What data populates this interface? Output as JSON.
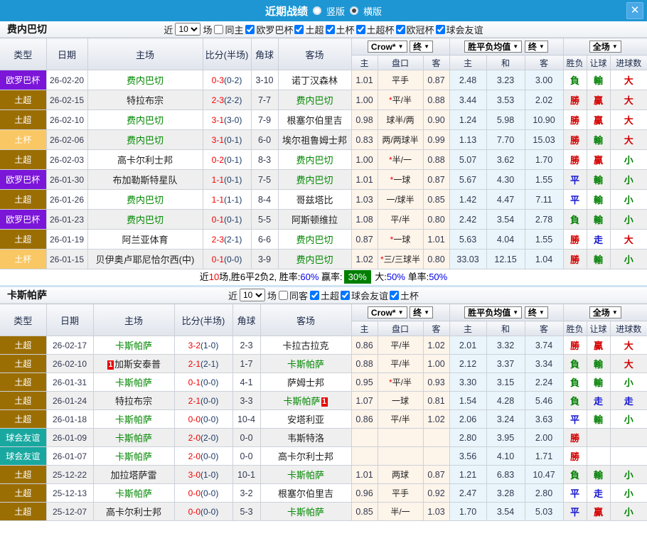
{
  "titlebar": {
    "title": "近期战绩",
    "layout_options": [
      {
        "label": "竖版",
        "checked": false
      },
      {
        "label": "横版",
        "checked": true
      }
    ],
    "close_icon": "✕"
  },
  "table_header": {
    "type": "类型",
    "date": "日期",
    "home": "主场",
    "score": "比分(半场)",
    "corner": "角球",
    "away": "客场",
    "crow": "Crow*",
    "final": "终",
    "avg": "胜平负均值",
    "full": "全场",
    "arrow": "▼",
    "sub": {
      "h": "主",
      "pan": "盘口",
      "a": "客",
      "mh": "主",
      "md": "和",
      "ma": "客",
      "res": "胜负",
      "let": "让球",
      "goal": "进球数"
    }
  },
  "type_colors": {
    "欧罗巴杯": "#7b16d8",
    "土超": "#9b6e04",
    "土杯": "#f9c763",
    "球会友谊": "#19a8a0"
  },
  "result_color_map": {
    "勝": "red",
    "負": "green",
    "平": "blue",
    "贏": "red",
    "輸": "green",
    "走": "blue",
    "大": "red",
    "小": "green"
  },
  "red_card_label": "1",
  "sections": [
    {
      "team": "费内巴切",
      "filter": {
        "label_near": "近",
        "count": "10",
        "label_games": "场",
        "same_label": "同主",
        "same_checked": false,
        "leagues": [
          {
            "label": "欧罗巴杯",
            "checked": true
          },
          {
            "label": "土超",
            "checked": true
          },
          {
            "label": "土杯",
            "checked": true
          },
          {
            "label": "土超杯",
            "checked": true
          },
          {
            "label": "欧冠杯",
            "checked": true
          },
          {
            "label": "球会友谊",
            "checked": true
          }
        ]
      },
      "rows": [
        {
          "type": "欧罗巴杯",
          "date": "26-02-20",
          "home": "费内巴切",
          "hg": true,
          "hcard": false,
          "away": "诺丁汉森林",
          "ag": false,
          "acard": false,
          "score": "0-3",
          "half": "(0-2)",
          "corner": "3-10",
          "oh": "1.01",
          "pan": "平手",
          "oa": "0.87",
          "mh": "2.48",
          "md": "3.23",
          "ma": "3.00",
          "r_wdl": "負",
          "r_let": "輸",
          "r_goal": "大"
        },
        {
          "type": "土超",
          "date": "26-02-15",
          "home": "特拉布宗",
          "hg": false,
          "hcard": false,
          "away": "费内巴切",
          "ag": true,
          "acard": false,
          "score": "2-3",
          "half": "(2-2)",
          "corner": "7-7",
          "oh": "1.00",
          "pan": "*平/半",
          "oa": "0.88",
          "mh": "3.44",
          "md": "3.53",
          "ma": "2.02",
          "r_wdl": "勝",
          "r_let": "贏",
          "r_goal": "大"
        },
        {
          "type": "土超",
          "date": "26-02-10",
          "home": "费内巴切",
          "hg": true,
          "hcard": false,
          "away": "根塞尔伯里吉",
          "ag": false,
          "acard": false,
          "score": "3-1",
          "half": "(3-0)",
          "corner": "7-9",
          "oh": "0.98",
          "pan": "球半/两",
          "oa": "0.90",
          "mh": "1.24",
          "md": "5.98",
          "ma": "10.90",
          "r_wdl": "勝",
          "r_let": "贏",
          "r_goal": "大"
        },
        {
          "type": "土杯",
          "date": "26-02-06",
          "home": "费内巴切",
          "hg": true,
          "hcard": false,
          "away": "埃尔祖鲁姆士邦",
          "ag": false,
          "acard": false,
          "score": "3-1",
          "half": "(0-1)",
          "corner": "6-0",
          "oh": "0.83",
          "pan": "两/两球半",
          "oa": "0.99",
          "mh": "1.13",
          "md": "7.70",
          "ma": "15.03",
          "r_wdl": "勝",
          "r_let": "輸",
          "r_goal": "大"
        },
        {
          "type": "土超",
          "date": "26-02-03",
          "home": "高卡尔利士邦",
          "hg": false,
          "hcard": false,
          "away": "费内巴切",
          "ag": true,
          "acard": false,
          "score": "0-2",
          "half": "(0-1)",
          "corner": "8-3",
          "oh": "1.00",
          "pan": "*半/一",
          "oa": "0.88",
          "mh": "5.07",
          "md": "3.62",
          "ma": "1.70",
          "r_wdl": "勝",
          "r_let": "贏",
          "r_goal": "小"
        },
        {
          "type": "欧罗巴杯",
          "date": "26-01-30",
          "home": "布加勒斯特星队",
          "hg": false,
          "hcard": false,
          "away": "费内巴切",
          "ag": true,
          "acard": false,
          "score": "1-1",
          "half": "(0-1)",
          "corner": "7-5",
          "oh": "1.01",
          "pan": "*一球",
          "oa": "0.87",
          "mh": "5.67",
          "md": "4.30",
          "ma": "1.55",
          "r_wdl": "平",
          "r_let": "輸",
          "r_goal": "小"
        },
        {
          "type": "土超",
          "date": "26-01-26",
          "home": "费内巴切",
          "hg": true,
          "hcard": false,
          "away": "哥兹塔比",
          "ag": false,
          "acard": false,
          "score": "1-1",
          "half": "(1-1)",
          "corner": "8-4",
          "oh": "1.03",
          "pan": "一/球半",
          "oa": "0.85",
          "mh": "1.42",
          "md": "4.47",
          "ma": "7.11",
          "r_wdl": "平",
          "r_let": "輸",
          "r_goal": "小"
        },
        {
          "type": "欧罗巴杯",
          "date": "26-01-23",
          "home": "费内巴切",
          "hg": true,
          "hcard": false,
          "away": "阿斯顿维拉",
          "ag": false,
          "acard": false,
          "score": "0-1",
          "half": "(0-1)",
          "corner": "5-5",
          "oh": "1.08",
          "pan": "平/半",
          "oa": "0.80",
          "mh": "2.42",
          "md": "3.54",
          "ma": "2.78",
          "r_wdl": "負",
          "r_let": "輸",
          "r_goal": "小"
        },
        {
          "type": "土超",
          "date": "26-01-19",
          "home": "阿兰亚体育",
          "hg": false,
          "hcard": false,
          "away": "费内巴切",
          "ag": true,
          "acard": false,
          "score": "2-3",
          "half": "(2-1)",
          "corner": "6-6",
          "oh": "0.87",
          "pan": "*一球",
          "oa": "1.01",
          "mh": "5.63",
          "md": "4.04",
          "ma": "1.55",
          "r_wdl": "勝",
          "r_let": "走",
          "r_goal": "大"
        },
        {
          "type": "土杯",
          "date": "26-01-15",
          "home": "贝伊奥卢耶尼恰尔西(中)",
          "hg": false,
          "hcard": false,
          "away": "费内巴切",
          "ag": true,
          "acard": false,
          "score": "0-1",
          "half": "(0-0)",
          "corner": "3-9",
          "oh": "1.02",
          "pan": "*三/三球半",
          "oa": "0.80",
          "mh": "33.03",
          "md": "12.15",
          "ma": "1.04",
          "r_wdl": "勝",
          "r_let": "輸",
          "r_goal": "小"
        }
      ],
      "summary": [
        {
          "style": "plain",
          "text": "近"
        },
        {
          "style": "red",
          "text": "10"
        },
        {
          "style": "plain",
          "text": "场,胜6平2负2, 胜率:"
        },
        {
          "style": "blue",
          "text": "60%"
        },
        {
          "style": "plain",
          "text": " 赢率:"
        },
        {
          "style": "hl",
          "text": "30%"
        },
        {
          "style": "plain",
          "text": " 大:"
        },
        {
          "style": "blue",
          "text": "50%"
        },
        {
          "style": "plain",
          "text": " 单率:"
        },
        {
          "style": "blue",
          "text": "50%"
        }
      ]
    },
    {
      "team": "卡斯帕萨",
      "filter": {
        "label_near": "近",
        "count": "10",
        "label_games": "场",
        "same_label": "同客",
        "same_checked": false,
        "leagues": [
          {
            "label": "土超",
            "checked": true
          },
          {
            "label": "球会友谊",
            "checked": true
          },
          {
            "label": "土杯",
            "checked": true
          }
        ]
      },
      "rows": [
        {
          "type": "土超",
          "date": "26-02-17",
          "home": "卡斯帕萨",
          "hg": true,
          "hcard": false,
          "away": "卡拉古拉克",
          "ag": false,
          "acard": false,
          "score": "3-2",
          "half": "(1-0)",
          "corner": "2-3",
          "oh": "0.86",
          "pan": "平/半",
          "oa": "1.02",
          "mh": "2.01",
          "md": "3.32",
          "ma": "3.74",
          "r_wdl": "勝",
          "r_let": "贏",
          "r_goal": "大"
        },
        {
          "type": "土超",
          "date": "26-02-10",
          "home": "加斯安泰普",
          "hg": false,
          "hcard": true,
          "away": "卡斯帕萨",
          "ag": true,
          "acard": false,
          "score": "2-1",
          "half": "(2-1)",
          "corner": "1-7",
          "oh": "0.88",
          "pan": "平/半",
          "oa": "1.00",
          "mh": "2.12",
          "md": "3.37",
          "ma": "3.34",
          "r_wdl": "負",
          "r_let": "輸",
          "r_goal": "大"
        },
        {
          "type": "土超",
          "date": "26-01-31",
          "home": "卡斯帕萨",
          "hg": true,
          "hcard": false,
          "away": "萨姆士邦",
          "ag": false,
          "acard": false,
          "score": "0-1",
          "half": "(0-0)",
          "corner": "4-1",
          "oh": "0.95",
          "pan": "*平/半",
          "oa": "0.93",
          "mh": "3.30",
          "md": "3.15",
          "ma": "2.24",
          "r_wdl": "負",
          "r_let": "輸",
          "r_goal": "小"
        },
        {
          "type": "土超",
          "date": "26-01-24",
          "home": "特拉布宗",
          "hg": false,
          "hcard": false,
          "away": "卡斯帕萨",
          "ag": true,
          "acard": true,
          "score": "2-1",
          "half": "(0-0)",
          "corner": "3-3",
          "oh": "1.07",
          "pan": "一球",
          "oa": "0.81",
          "mh": "1.54",
          "md": "4.28",
          "ma": "5.46",
          "r_wdl": "負",
          "r_let": "走",
          "r_goal": "走"
        },
        {
          "type": "土超",
          "date": "26-01-18",
          "home": "卡斯帕萨",
          "hg": true,
          "hcard": false,
          "away": "安塔利亚",
          "ag": false,
          "acard": false,
          "score": "0-0",
          "half": "(0-0)",
          "corner": "10-4",
          "oh": "0.86",
          "pan": "平/半",
          "oa": "1.02",
          "mh": "2.06",
          "md": "3.24",
          "ma": "3.63",
          "r_wdl": "平",
          "r_let": "輸",
          "r_goal": "小"
        },
        {
          "type": "球会友谊",
          "date": "26-01-09",
          "home": "卡斯帕萨",
          "hg": true,
          "hcard": false,
          "away": "韦斯特洛",
          "ag": false,
          "acard": false,
          "score": "2-0",
          "half": "(2-0)",
          "corner": "0-0",
          "oh": "",
          "pan": "",
          "oa": "",
          "mh": "2.80",
          "md": "3.95",
          "ma": "2.00",
          "r_wdl": "勝",
          "r_let": "",
          "r_goal": ""
        },
        {
          "type": "球会友谊",
          "date": "26-01-07",
          "home": "卡斯帕萨",
          "hg": true,
          "hcard": false,
          "away": "高卡尔利士邦",
          "ag": false,
          "acard": false,
          "score": "2-0",
          "half": "(0-0)",
          "corner": "0-0",
          "oh": "",
          "pan": "",
          "oa": "",
          "mh": "3.56",
          "md": "4.10",
          "ma": "1.71",
          "r_wdl": "勝",
          "r_let": "",
          "r_goal": ""
        },
        {
          "type": "土超",
          "date": "25-12-22",
          "home": "加拉塔萨雷",
          "hg": false,
          "hcard": false,
          "away": "卡斯帕萨",
          "ag": true,
          "acard": false,
          "score": "3-0",
          "half": "(1-0)",
          "corner": "10-1",
          "oh": "1.01",
          "pan": "两球",
          "oa": "0.87",
          "mh": "1.21",
          "md": "6.83",
          "ma": "10.47",
          "r_wdl": "負",
          "r_let": "輸",
          "r_goal": "小"
        },
        {
          "type": "土超",
          "date": "25-12-13",
          "home": "卡斯帕萨",
          "hg": true,
          "hcard": false,
          "away": "根塞尔伯里吉",
          "ag": false,
          "acard": false,
          "score": "0-0",
          "half": "(0-0)",
          "corner": "3-2",
          "oh": "0.96",
          "pan": "平手",
          "oa": "0.92",
          "mh": "2.47",
          "md": "3.28",
          "ma": "2.80",
          "r_wdl": "平",
          "r_let": "走",
          "r_goal": "小"
        },
        {
          "type": "土超",
          "date": "25-12-07",
          "home": "高卡尔利士邦",
          "hg": false,
          "hcard": false,
          "away": "卡斯帕萨",
          "ag": true,
          "acard": false,
          "score": "0-0",
          "half": "(0-0)",
          "corner": "5-3",
          "oh": "0.85",
          "pan": "半/一",
          "oa": "1.03",
          "mh": "1.70",
          "md": "3.54",
          "ma": "5.03",
          "r_wdl": "平",
          "r_let": "贏",
          "r_goal": "小"
        }
      ],
      "summary": null
    }
  ]
}
